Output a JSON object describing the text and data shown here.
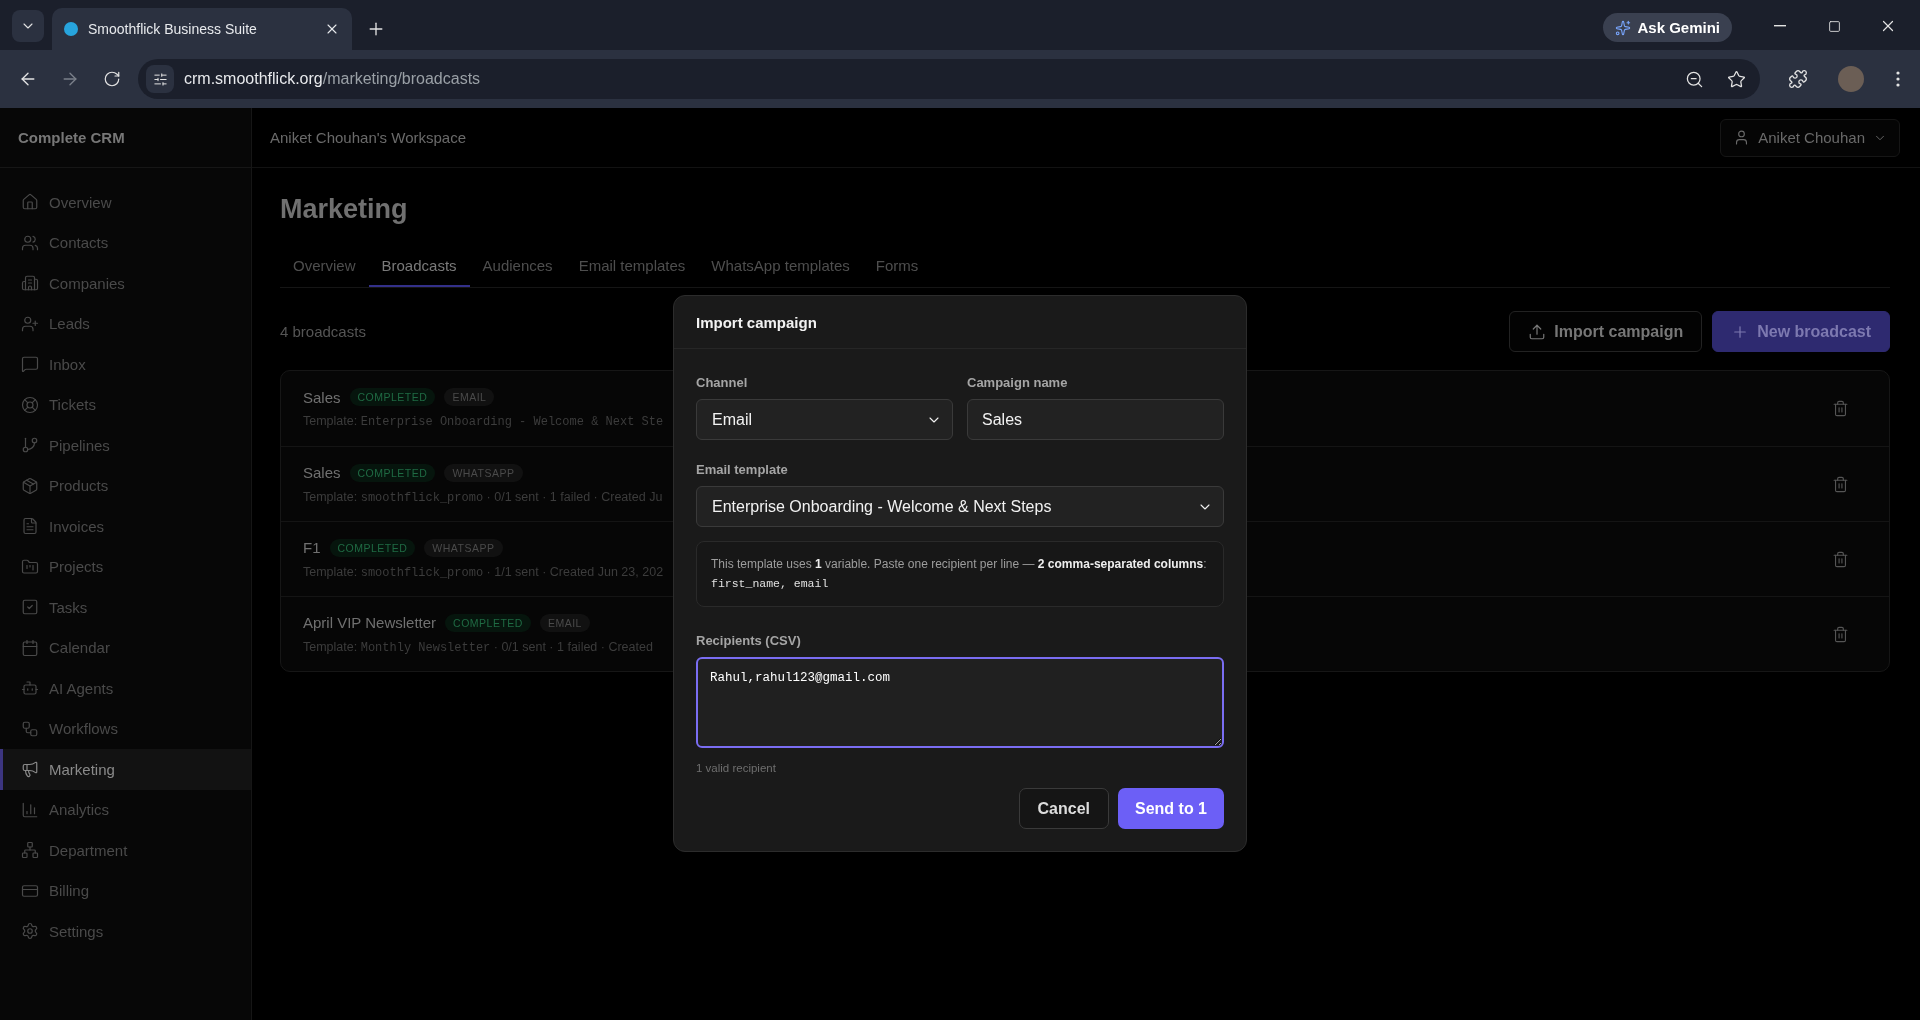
{
  "browser": {
    "tab_title": "Smoothflick Business Suite",
    "url_host": "crm.smoothflick.org",
    "url_path": "/marketing/broadcasts",
    "gemini_label": "Ask Gemini"
  },
  "sidebar": {
    "title": "Complete CRM",
    "items": [
      {
        "label": "Overview",
        "selected": false
      },
      {
        "label": "Contacts",
        "selected": false
      },
      {
        "label": "Companies",
        "selected": false
      },
      {
        "label": "Leads",
        "selected": false
      },
      {
        "label": "Inbox",
        "selected": false
      },
      {
        "label": "Tickets",
        "selected": false
      },
      {
        "label": "Pipelines",
        "selected": false
      },
      {
        "label": "Products",
        "selected": false
      },
      {
        "label": "Invoices",
        "selected": false
      },
      {
        "label": "Projects",
        "selected": false
      },
      {
        "label": "Tasks",
        "selected": false
      },
      {
        "label": "Calendar",
        "selected": false
      },
      {
        "label": "AI Agents",
        "selected": false
      },
      {
        "label": "Workflows",
        "selected": false
      },
      {
        "label": "Marketing",
        "selected": true
      },
      {
        "label": "Analytics",
        "selected": false
      },
      {
        "label": "Department",
        "selected": false
      },
      {
        "label": "Billing",
        "selected": false
      },
      {
        "label": "Settings",
        "selected": false
      }
    ]
  },
  "header": {
    "workspace": "Aniket Chouhan's Workspace",
    "user": "Aniket Chouhan"
  },
  "page": {
    "title": "Marketing",
    "tabs": [
      {
        "label": "Overview",
        "selected": false
      },
      {
        "label": "Broadcasts",
        "selected": true
      },
      {
        "label": "Audiences",
        "selected": false
      },
      {
        "label": "Email templates",
        "selected": false
      },
      {
        "label": "WhatsApp templates",
        "selected": false
      },
      {
        "label": "Forms",
        "selected": false
      }
    ],
    "count": "4 broadcasts",
    "import_button": "Import campaign",
    "new_button": "New broadcast",
    "broadcasts": [
      {
        "name": "Sales",
        "status": "COMPLETED",
        "channel": "EMAIL",
        "prefix": "Template:",
        "template": "Enterprise Onboarding - Welcome & Next Ste"
      },
      {
        "name": "Sales",
        "status": "COMPLETED",
        "channel": "WHATSAPP",
        "prefix": "Template:",
        "template": "smoothflick_promo",
        "details": "· 0/1 sent · 1 failed · Created Ju"
      },
      {
        "name": "F1",
        "status": "COMPLETED",
        "channel": "WHATSAPP",
        "prefix": "Template:",
        "template": "smoothflick_promo",
        "details": "· 1/1 sent · Created Jun 23, 202"
      },
      {
        "name": "April VIP Newsletter",
        "status": "COMPLETED",
        "channel": "EMAIL",
        "prefix": "Template:",
        "template": "Monthly Newsletter",
        "details": "· 0/1 sent · 1 failed · Created"
      }
    ]
  },
  "dialog": {
    "title": "Import campaign",
    "channel_label": "Channel",
    "channel_value": "Email",
    "name_label": "Campaign name",
    "name_value": "Sales",
    "template_label": "Email template",
    "template_value": "Enterprise Onboarding - Welcome & Next Steps",
    "info": "This template uses **1** variable. Paste one recipient per line — **2 comma-separated columns**:",
    "info_columns": "first_name, email",
    "recipients_label": "Recipients (CSV)",
    "recipients_value": "Rahul,rahul123@gmail.com",
    "recipients_focused": true,
    "hint": "1 valid recipient",
    "cancel": "Cancel",
    "submit": "Send to 1"
  }
}
